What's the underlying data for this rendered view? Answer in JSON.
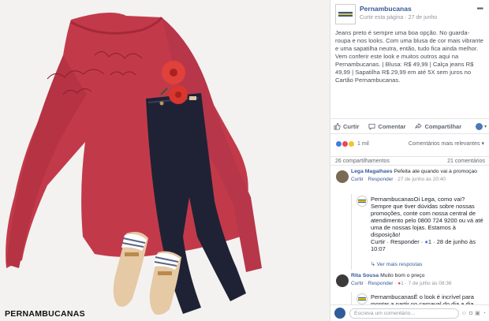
{
  "photo": {
    "brand_watermark": "PERNAMBUCANAS",
    "colors": {
      "blouse": "#c23a4a",
      "jeans": "#1f2235",
      "background": "#f3f2f0",
      "flower": "#e0413a"
    }
  },
  "post": {
    "page_name": "Pernambucanas",
    "meta_prefix": "Curtir esta página",
    "meta_separator": "·",
    "date": "27 de junho",
    "more_icon": "ellipsis-icon",
    "text": "Jeans preto é sempre uma boa opção. No guarda-roupa e nos looks. Com uma blusa de cor mais vibrante e uma sapatilha neutra, então, tudo fica ainda melhor. Vem conferir este look e muitos outros aqui na Pernambucanas. | Blusa: R$ 49,99 | Calça jeans R$ 49,99 | Sapatilha R$ 29,99 em até 5X sem juros no Cartão Pernambucanas."
  },
  "actions": {
    "like": "Curtir",
    "comment": "Comentar",
    "share": "Compartilhar"
  },
  "reactions": {
    "count": "1 mil",
    "sort": "Comentários mais relevantes",
    "colors": {
      "like": "#4a79d6",
      "love": "#e9465b",
      "wow": "#f3c32f"
    }
  },
  "counts": {
    "shares": "26 compartilhamentos",
    "comments": "21 comentários"
  },
  "comments": [
    {
      "author": "Lega Magalhaes",
      "text": "Pefeita ate quando vai a promoçao",
      "like": "Curtir",
      "reply": "Responder",
      "time": "27 de junho às 20:40",
      "avatar_color": "#7a6a55"
    },
    {
      "author": "Pernambucanas",
      "text": "Oi Lega, como vai? Sempre que tiver dúvidas sobre nossas promoções, conte com nossa central de atendimento pelo 0800 724 9200 ou vá até uma de nossas lojas. Estamos à disposição!",
      "like": "Curtir",
      "reply": "Responder",
      "reactions": "1",
      "time": "28 de junho às 10:07"
    },
    {
      "see_replies": "Ver mais respostas"
    },
    {
      "author": "Rita Sousa",
      "text": "Muito bom o preço",
      "like": "Curtir",
      "reply": "Responder",
      "reactions": "1",
      "time": "7 de julho às 08:36",
      "avatar_color": "#3b3b3b"
    },
    {
      "author": "Pernambucanas",
      "text": "É o look é incrível para montar a partir no carnaval do dia a dia..."
    }
  ],
  "composer": {
    "placeholder": "Escreva um comentário...",
    "icons": [
      "smiley-icon",
      "camera-icon",
      "gif-icon",
      "sticker-icon"
    ]
  }
}
